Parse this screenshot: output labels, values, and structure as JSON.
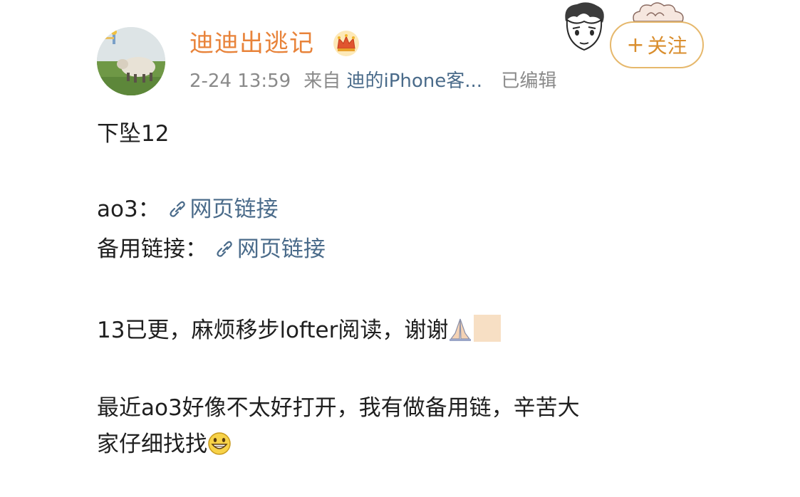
{
  "post": {
    "username": "迪迪出逃记",
    "timestamp": "2-24 13:59",
    "source_prefix": "来自",
    "source": "迪的iPhone客...",
    "edited": "已编辑",
    "follow_label": "关注",
    "follow_plus": "+"
  },
  "content": {
    "line1": "下坠12",
    "ao3_label": "ao3：",
    "ao3_link": "网页链接",
    "backup_label": "备用链接：",
    "backup_link": "网页链接",
    "update_text": "13已更，麻烦移步lofter阅读，谢谢",
    "notice_line1": "最近ao3好像不太好打开，我有做备用链，辛苦大",
    "notice_line2": "家仔细找找"
  },
  "icons": {
    "crown": "crown-badge-icon",
    "link": "link-chain-icon",
    "pray": "praying-hands-emoji",
    "grin": "grinning-face-emoji"
  },
  "colors": {
    "username": "#e8833a",
    "meta": "#8a8a8a",
    "link": "#4a6b8a",
    "follow_border": "#e6b86c",
    "follow_text": "#d98e2e"
  }
}
